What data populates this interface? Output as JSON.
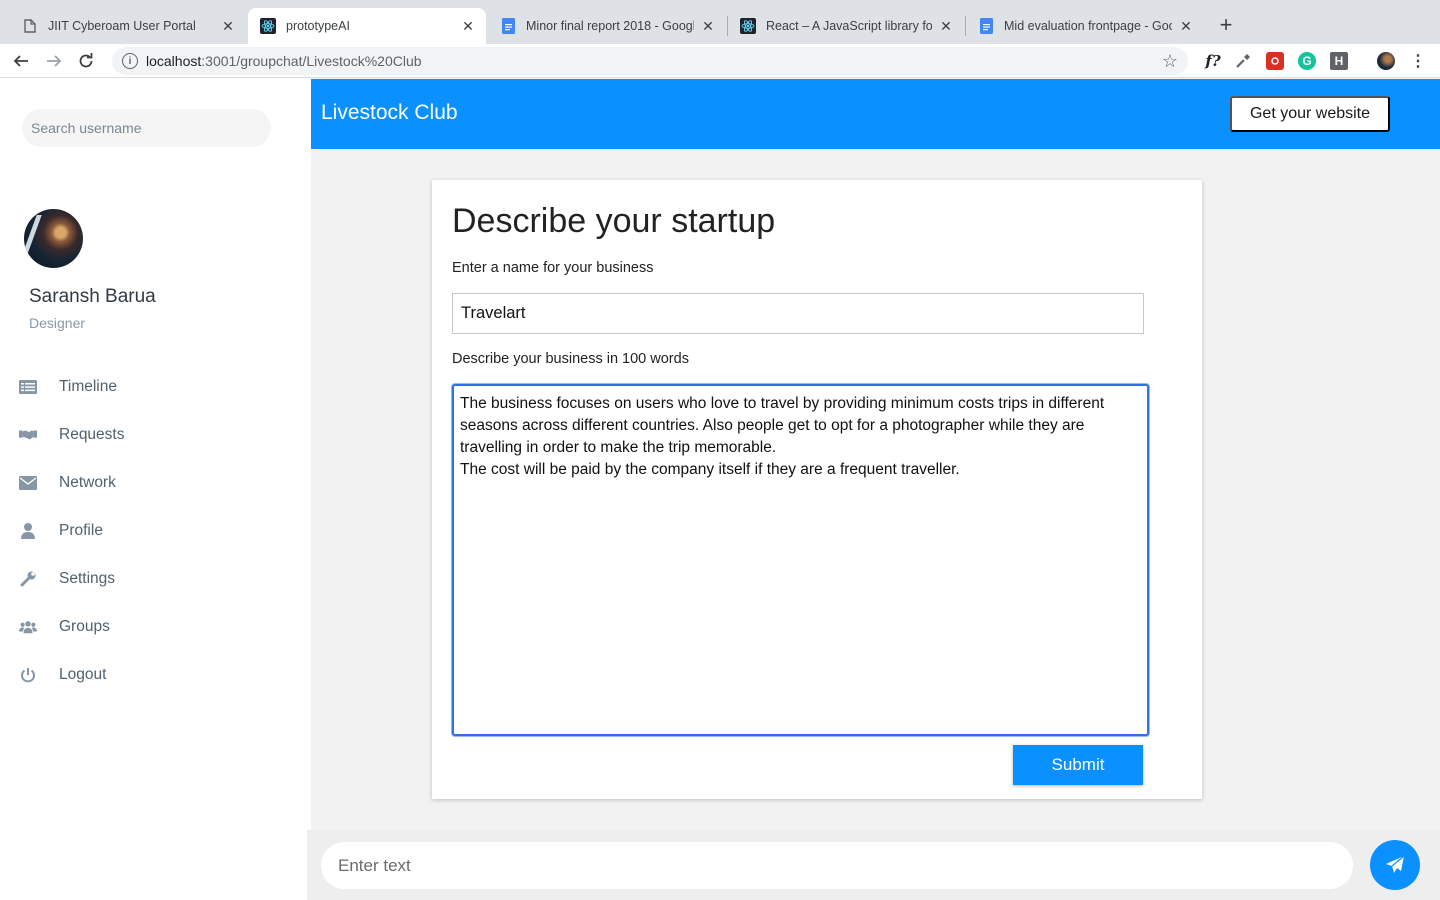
{
  "browser": {
    "tabs": [
      {
        "label": "JIIT Cyberoam User Portal",
        "icon": "page-icon"
      },
      {
        "label": "prototypeAI",
        "icon": "react-icon"
      },
      {
        "label": "Minor final report 2018 - Googl",
        "icon": "docs-icon"
      },
      {
        "label": "React – A JavaScript library for",
        "icon": "react-icon"
      },
      {
        "label": "Mid evaluation frontpage - Goo",
        "icon": "docs-icon"
      }
    ],
    "active_tab": 1,
    "url_host": "localhost",
    "url_path": ":3001/groupchat/Livestock%20Club",
    "extension_f_label": "f?",
    "extension_h_label": "H"
  },
  "sidebar": {
    "search_placeholder": "Search username",
    "user": {
      "name": "Saransh Barua",
      "role": "Designer"
    },
    "items": [
      {
        "label": "Timeline",
        "icon": "list-icon"
      },
      {
        "label": "Requests",
        "icon": "handshake-icon"
      },
      {
        "label": "Network",
        "icon": "envelope-icon"
      },
      {
        "label": "Profile",
        "icon": "user-icon"
      },
      {
        "label": "Settings",
        "icon": "wrench-icon"
      },
      {
        "label": "Groups",
        "icon": "users-icon"
      },
      {
        "label": "Logout",
        "icon": "power-icon"
      }
    ]
  },
  "header": {
    "title": "Livestock Club",
    "cta_label": "Get your website"
  },
  "form": {
    "title": "Describe your startup",
    "name_label": "Enter a name for your business",
    "name_value": "Travelart",
    "desc_label": "Describe your business in 100 words",
    "desc_value": "The business focuses on users who love to travel by providing minimum costs trips in different seasons across different countries. Also people get to opt for a photographer while they are travelling in order to make the trip memorable.\nThe cost will be paid by the company itself if they are a frequent traveller.",
    "submit_label": "Submit"
  },
  "chat": {
    "input_placeholder": "Enter text"
  },
  "colors": {
    "primary": "#0a91ff",
    "focus_border": "#2f6fe8",
    "sidebar_text": "#51616e"
  }
}
